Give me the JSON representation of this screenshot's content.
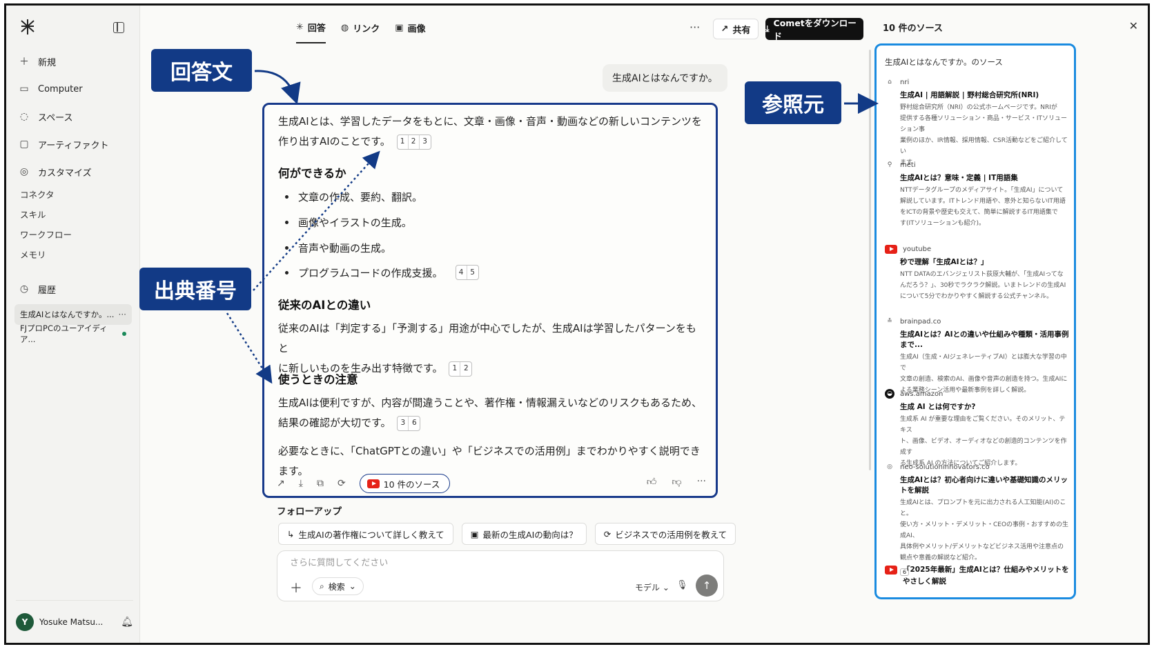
{
  "sidebar": {
    "items": [
      {
        "label": "新規"
      },
      {
        "label": "Computer"
      },
      {
        "label": "スペース"
      },
      {
        "label": "アーティファクト"
      },
      {
        "label": "カスタマイズ"
      }
    ],
    "subitems": [
      "コネクタ",
      "スキル",
      "ワークフロー",
      "メモリ"
    ],
    "history_label": "履歴",
    "threads": [
      "生成AIとはなんですか。...",
      "FJプロPCのユーアイディア..."
    ],
    "user_name": "Yosuke Matsu...",
    "user_initial": "Y"
  },
  "topbar": {
    "tabs": [
      "回答",
      "リンク",
      "画像"
    ],
    "more": "···",
    "share_label": "共有",
    "download_label": "Cometをダウンロード"
  },
  "question": "生成AIとはなんですか。",
  "answer": {
    "intro_line1": "生成AIとは、学習したデータをもとに、文章・画像・音声・動画などの新しいコンテンツを",
    "intro_line2": "作り出すAIのことです。",
    "intro_cites": [
      "1",
      "2",
      "3"
    ],
    "h_can": "何ができるか",
    "bullets": [
      "文章の作成、要約、翻訳。",
      "画像やイラストの生成。",
      "音声や動画の生成。",
      "プログラムコードの作成支援。"
    ],
    "bullet4_cites": [
      "4",
      "5"
    ],
    "h_diff": "従来のAIとの違い",
    "diff_line1": "従来のAIは「判定する」「予測する」用途が中心でしたが、生成AIは学習したパターンをもと",
    "diff_line2": "に新しいものを生み出す特徴です。",
    "diff_cites": [
      "1",
      "2"
    ],
    "h_caution": "使うときの注意",
    "caution_line1": "生成AIは便利ですが、内容が間違うことや、著作権・情報漏えいなどのリスクもあるため、",
    "caution_line2": "結果の確認が大切です。",
    "caution_cites": [
      "3",
      "6"
    ],
    "closing": "必要なときに、「ChatGPTとの違い」や「ビジネスでの活用例」までわかりやすく説明できます。",
    "sources_pill": "10 件のソース"
  },
  "followup": {
    "title": "フォローアップ",
    "items": [
      "生成AIの著作権について詳しく教えて",
      "最新の生成AIの動向は？",
      "ビジネスでの活用例を教えて"
    ]
  },
  "input": {
    "placeholder": "さらに質問してください",
    "search_mode": "検索",
    "model_label": "モデル"
  },
  "right_panel": {
    "title": "10 件のソース",
    "box_title": "生成AIとはなんですか。のソース",
    "sources": [
      {
        "site": "nri",
        "title": "生成AI | 用語解説 | 野村総合研究所(NRI)",
        "desc": [
          "野村総合研究所（NRI）の公式ホームページです。NRIが",
          "提供する各種ソリューション・商品・サービス・ITソリューション事",
          "業例のほか、IR情報、採用情報、CSR活動などをご紹介してい",
          "ます"
        ]
      },
      {
        "site": "meti",
        "title": "生成AIとは？意味・定義 | IT用語集",
        "desc": [
          "NTTデータグループのメディアサイト。「生成AI」について",
          "解説しています。ITトレンド用語や、意外と知らないIT用語",
          "をICTの背景や歴史も交えて、簡単に解説するIT用語集で",
          "す(ITソリューションも紹介)。"
        ]
      },
      {
        "site": "youtube",
        "title": "秒で理解「生成AIとは？」",
        "desc": [
          "NTT DATAのエバンジェリスト荻原大輔が、「生成AIってな",
          "んだろう？」、30秒でラクラク解説。いまトレンドの生成AI",
          "について5分でわかりやすく解説する公式チャンネル。"
        ]
      },
      {
        "site": "brainpad.co",
        "title": "生成AIとは？AIとの違いや仕組みや種類・活用事例まで...",
        "desc": [
          "生成AI（生成・AIジェネレーティブAI）とは膨大な学習の中で",
          "文章の創造、検索のAI、画像や音声の創造を持つ。生成AIに",
          "よる業務シーン活用や最新事例を詳しく解説。"
        ]
      },
      {
        "site": "aws.amazon",
        "title": "生成 AI とは何ですか?",
        "desc": [
          "生成系 AI が重要な理由をご覧ください。そのメリット、テキス",
          "ト、画像、ビデオ、オーディオなどの創造的コンテンツを作成す",
          "る生成系 AI の方法についてご紹介します。"
        ]
      },
      {
        "site": "neo-solutioninnovators.co",
        "title": "生成AIとは？初心者向けに違いや基礎知識のメリットを解説",
        "desc": [
          "生成AIとは、プロンプトを元に出力される人工知能(AI)のこと。",
          "使い方・メリット・デメリット・CEOの事例・おすすめの生成AI、",
          "具体例やメリット/デメリットなどビジネス活用や注意点の",
          "観点や意義の解説など紹介。"
        ],
        "badge": "6"
      },
      {
        "site": "",
        "title": "「2025年最新」生成AIとは？仕組みやメリットを",
        "title2": "やさしく解説",
        "desc": []
      }
    ]
  },
  "annotations": {
    "answer_label": "回答文",
    "source_label": "参照元",
    "cite_label": "出典番号"
  },
  "colors": {
    "annotation_bg": "#123a86",
    "sources_border": "#1a8be0",
    "youtube_red": "#e62117"
  }
}
